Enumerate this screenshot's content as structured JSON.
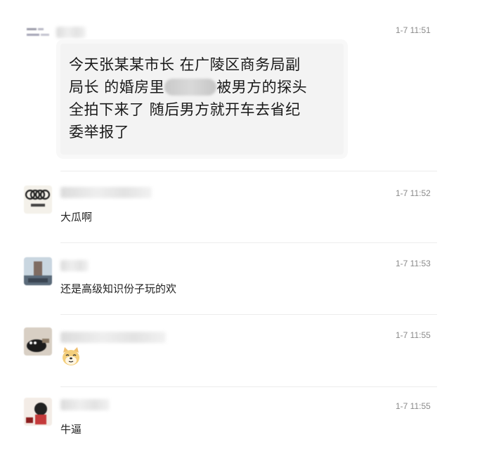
{
  "messages": [
    {
      "time": "1-7 11:51",
      "text_lines": [
        "今天张某某市长 在广陵区商务局副",
        "局长 的婚房里",
        "被男方的探头",
        "全拍下来了 随后男方就开车去省纪",
        "委举报了"
      ]
    },
    {
      "time": "1-7 11:52",
      "text": "大瓜啊"
    },
    {
      "time": "1-7 11:53",
      "text": "还是高级知识份子玩的欢"
    },
    {
      "time": "1-7 11:55",
      "emoji": "doge-emoji"
    },
    {
      "time": "1-7 11:55",
      "text": "牛逼"
    }
  ],
  "colors": {
    "bubble_bg": "#f3f3f3",
    "time_text": "#8a8a8a",
    "divider": "#ececec"
  }
}
